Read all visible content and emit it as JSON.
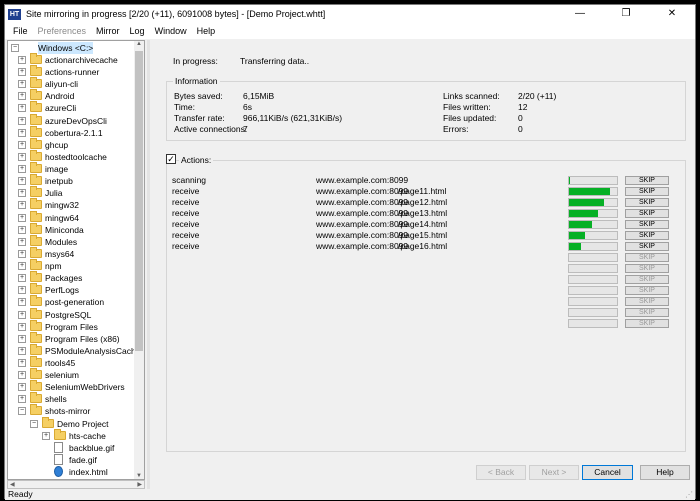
{
  "window": {
    "app_icon_text": "HT",
    "title": "Site mirroring in progress [2/20 (+11), 6091008 bytes] - [Demo Project.whtt]",
    "minimize_glyph": "—",
    "restore_glyph": "❐",
    "close_glyph": "✕"
  },
  "menu": [
    {
      "label": "File",
      "disabled": false
    },
    {
      "label": "Preferences",
      "disabled": true
    },
    {
      "label": "Mirror",
      "disabled": false
    },
    {
      "label": "Log",
      "disabled": false
    },
    {
      "label": "Window",
      "disabled": false
    },
    {
      "label": "Help",
      "disabled": false
    }
  ],
  "tree": {
    "root_label": "Windows <C:>",
    "items": [
      {
        "label": "actionarchivecache",
        "level": 1,
        "type": "folder",
        "expander": "+"
      },
      {
        "label": "actions-runner",
        "level": 1,
        "type": "folder",
        "expander": "+"
      },
      {
        "label": "aliyun-cli",
        "level": 1,
        "type": "folder",
        "expander": "+"
      },
      {
        "label": "Android",
        "level": 1,
        "type": "folder",
        "expander": "+"
      },
      {
        "label": "azureCli",
        "level": 1,
        "type": "folder",
        "expander": "+"
      },
      {
        "label": "azureDevOpsCli",
        "level": 1,
        "type": "folder",
        "expander": "+"
      },
      {
        "label": "cobertura-2.1.1",
        "level": 1,
        "type": "folder",
        "expander": "+"
      },
      {
        "label": "ghcup",
        "level": 1,
        "type": "folder",
        "expander": "+"
      },
      {
        "label": "hostedtoolcache",
        "level": 1,
        "type": "folder",
        "expander": "+"
      },
      {
        "label": "image",
        "level": 1,
        "type": "folder",
        "expander": "+"
      },
      {
        "label": "inetpub",
        "level": 1,
        "type": "folder",
        "expander": "+"
      },
      {
        "label": "Julia",
        "level": 1,
        "type": "folder",
        "expander": "+"
      },
      {
        "label": "mingw32",
        "level": 1,
        "type": "folder",
        "expander": "+"
      },
      {
        "label": "mingw64",
        "level": 1,
        "type": "folder",
        "expander": "+"
      },
      {
        "label": "Miniconda",
        "level": 1,
        "type": "folder",
        "expander": "+"
      },
      {
        "label": "Modules",
        "level": 1,
        "type": "folder",
        "expander": "+"
      },
      {
        "label": "msys64",
        "level": 1,
        "type": "folder",
        "expander": "+"
      },
      {
        "label": "npm",
        "level": 1,
        "type": "folder",
        "expander": "+"
      },
      {
        "label": "Packages",
        "level": 1,
        "type": "folder",
        "expander": "+"
      },
      {
        "label": "PerfLogs",
        "level": 1,
        "type": "folder",
        "expander": "+"
      },
      {
        "label": "post-generation",
        "level": 1,
        "type": "folder",
        "expander": "+"
      },
      {
        "label": "PostgreSQL",
        "level": 1,
        "type": "folder",
        "expander": "+"
      },
      {
        "label": "Program Files",
        "level": 1,
        "type": "folder",
        "expander": "+"
      },
      {
        "label": "Program Files (x86)",
        "level": 1,
        "type": "folder",
        "expander": "+"
      },
      {
        "label": "PSModuleAnalysisCach",
        "level": 1,
        "type": "folder",
        "expander": "+"
      },
      {
        "label": "rtools45",
        "level": 1,
        "type": "folder",
        "expander": "+"
      },
      {
        "label": "selenium",
        "level": 1,
        "type": "folder",
        "expander": "+"
      },
      {
        "label": "SeleniumWebDrivers",
        "level": 1,
        "type": "folder",
        "expander": "+"
      },
      {
        "label": "shells",
        "level": 1,
        "type": "folder",
        "expander": "+"
      },
      {
        "label": "shots-mirror",
        "level": 1,
        "type": "folder",
        "expander": "−"
      },
      {
        "label": "Demo Project",
        "level": 2,
        "type": "folder",
        "expander": "−"
      },
      {
        "label": "hts-cache",
        "level": 3,
        "type": "folder",
        "expander": "+"
      },
      {
        "label": "backblue.gif",
        "level": 3,
        "type": "file",
        "expander": ""
      },
      {
        "label": "fade.gif",
        "level": 3,
        "type": "file",
        "expander": ""
      },
      {
        "label": "index.html",
        "level": 3,
        "type": "edge",
        "expander": ""
      }
    ]
  },
  "progress": {
    "in_progress_label": "In progress:",
    "in_progress_value": "Transferring data.."
  },
  "information": {
    "title": "Information",
    "left": [
      {
        "label": "Bytes saved:",
        "value": "6,15MiB"
      },
      {
        "label": "Time:",
        "value": "6s"
      },
      {
        "label": "Transfer rate:",
        "value": "966,11KiB/s (621,31KiB/s)"
      },
      {
        "label": "Active connections:",
        "value": "7"
      }
    ],
    "right": [
      {
        "label": "Links scanned:",
        "value": "2/20 (+11)"
      },
      {
        "label": "Files written:",
        "value": "12"
      },
      {
        "label": "Files updated:",
        "value": "0"
      },
      {
        "label": "Errors:",
        "value": "0"
      }
    ]
  },
  "actions": {
    "checkbox_mark": "✓",
    "label": "Actions:",
    "skip_label": "SKIP",
    "rows": [
      {
        "action": "scanning",
        "host": "www.example.com:8099",
        "path": "",
        "progress": 0.02,
        "active": true
      },
      {
        "action": "receive",
        "host": "www.example.com:8099",
        "path": "/page11.html",
        "progress": 0.85,
        "active": true
      },
      {
        "action": "receive",
        "host": "www.example.com:8099",
        "path": "/page12.html",
        "progress": 0.72,
        "active": true
      },
      {
        "action": "receive",
        "host": "www.example.com:8099",
        "path": "/page13.html",
        "progress": 0.6,
        "active": true
      },
      {
        "action": "receive",
        "host": "www.example.com:8099",
        "path": "/page14.html",
        "progress": 0.48,
        "active": true
      },
      {
        "action": "receive",
        "host": "www.example.com:8099",
        "path": "/page15.html",
        "progress": 0.34,
        "active": true
      },
      {
        "action": "receive",
        "host": "www.example.com:8099",
        "path": "/page16.html",
        "progress": 0.24,
        "active": true
      },
      {
        "action": "",
        "host": "",
        "path": "",
        "progress": 0,
        "active": false
      },
      {
        "action": "",
        "host": "",
        "path": "",
        "progress": 0,
        "active": false
      },
      {
        "action": "",
        "host": "",
        "path": "",
        "progress": 0,
        "active": false
      },
      {
        "action": "",
        "host": "",
        "path": "",
        "progress": 0,
        "active": false
      },
      {
        "action": "",
        "host": "",
        "path": "",
        "progress": 0,
        "active": false
      },
      {
        "action": "",
        "host": "",
        "path": "",
        "progress": 0,
        "active": false
      },
      {
        "action": "",
        "host": "",
        "path": "",
        "progress": 0,
        "active": false
      }
    ]
  },
  "buttons": {
    "back": "< Back",
    "next": "Next >",
    "cancel": "Cancel",
    "help": "Help"
  },
  "status": {
    "text": "Ready"
  },
  "colors": {
    "progress_fill": "#06b025",
    "selection": "#cce8ff",
    "default_button_border": "#0078d7"
  }
}
